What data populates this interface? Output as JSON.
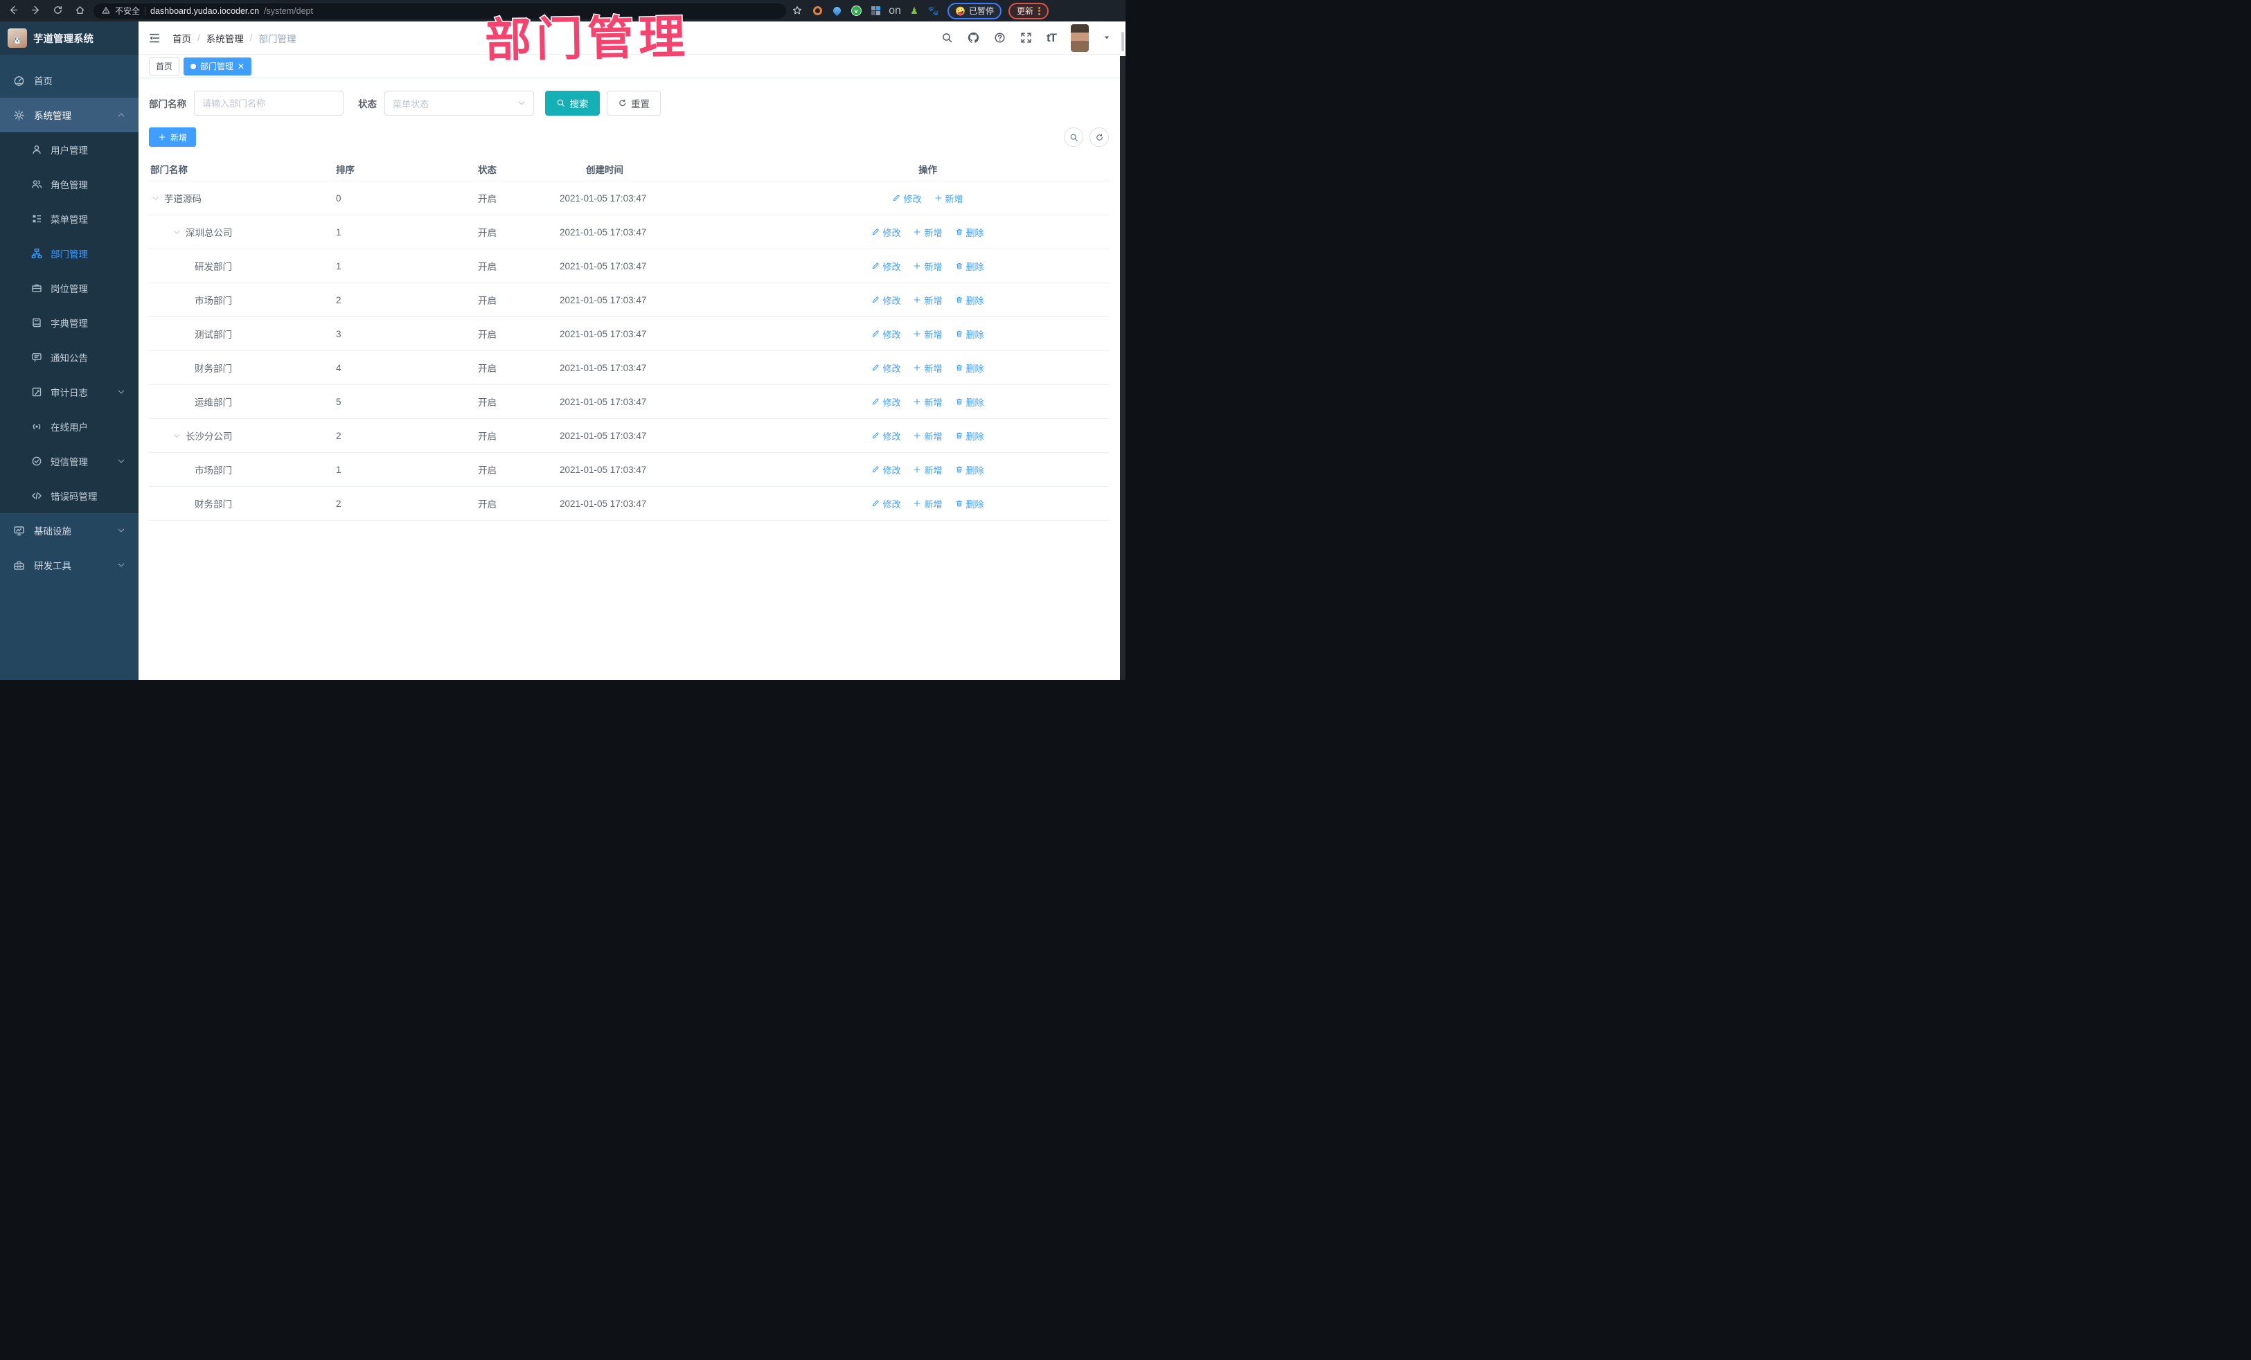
{
  "browser": {
    "security_label": "不安全",
    "url_host": "dashboard.yudao.iocoder.cn",
    "url_path": "/system/dept",
    "paused_label": "已暂停",
    "paused_emoji": "🤪",
    "update_label": "更新",
    "extensions": [
      {
        "name": "extension-orange-ring",
        "type": "ring"
      },
      {
        "name": "extension-blue-drop",
        "type": "drop"
      },
      {
        "name": "extension-green-check",
        "type": "green",
        "glyph": "v"
      },
      {
        "name": "extension-grid",
        "type": "grid"
      },
      {
        "name": "extension-translate-on",
        "type": "onbadge",
        "badge": "on"
      },
      {
        "name": "extension-green-figure",
        "type": "figure",
        "glyph": "♟"
      },
      {
        "name": "extension-paw",
        "type": "paw",
        "glyph": "🐾"
      }
    ]
  },
  "annotation": {
    "text": "部门管理",
    "color": "#f4436e"
  },
  "sidebar": {
    "logo_title": "芋道管理系统",
    "logo_emoji": "🐰",
    "menu": [
      {
        "key": "home",
        "icon": "dashboard",
        "label": "首页"
      },
      {
        "key": "system",
        "icon": "gear",
        "label": "系统管理",
        "chevron": "up",
        "highlight": true,
        "children": [
          {
            "key": "user",
            "icon": "user",
            "label": "用户管理"
          },
          {
            "key": "role",
            "icon": "users",
            "label": "角色管理"
          },
          {
            "key": "menu",
            "icon": "menulist",
            "label": "菜单管理"
          },
          {
            "key": "dept",
            "icon": "depttree",
            "label": "部门管理",
            "active": true
          },
          {
            "key": "post",
            "icon": "briefcase",
            "label": "岗位管理"
          },
          {
            "key": "dict",
            "icon": "book",
            "label": "字典管理"
          },
          {
            "key": "notice",
            "icon": "bubble",
            "label": "通知公告"
          },
          {
            "key": "audit",
            "icon": "audit",
            "label": "审计日志",
            "chevron": "down"
          },
          {
            "key": "online",
            "icon": "online",
            "label": "在线用户"
          },
          {
            "key": "sms",
            "icon": "badge",
            "label": "短信管理",
            "chevron": "down"
          },
          {
            "key": "errcode",
            "icon": "code",
            "label": "错误码管理"
          }
        ]
      },
      {
        "key": "infra",
        "icon": "monitor",
        "label": "基础设施",
        "chevron": "down"
      },
      {
        "key": "devtool",
        "icon": "toolbox",
        "label": "研发工具",
        "chevron": "down"
      }
    ]
  },
  "header": {
    "breadcrumb": [
      "首页",
      "系统管理",
      "部门管理"
    ],
    "icons": [
      {
        "name": "search-icon",
        "icon": "magnifier"
      },
      {
        "name": "github-icon",
        "icon": "github"
      },
      {
        "name": "help-icon",
        "icon": "question"
      },
      {
        "name": "fullscreen-icon",
        "icon": "fullscreen"
      },
      {
        "name": "font-size-icon",
        "icon": "fontsize",
        "glyph": "tT"
      }
    ]
  },
  "tabs": [
    {
      "label": "首页",
      "active": false,
      "closable": false
    },
    {
      "label": "部门管理",
      "active": true,
      "closable": true
    }
  ],
  "filters": {
    "name_label": "部门名称",
    "name_placeholder": "请输入部门名称",
    "status_label": "状态",
    "status_placeholder": "菜单状态",
    "search_label": "搜索",
    "reset_label": "重置"
  },
  "toolbar": {
    "add_label": "新增"
  },
  "table": {
    "headers": [
      "部门名称",
      "排序",
      "状态",
      "创建时间",
      "操作"
    ],
    "rows": [
      {
        "name": "芋道源码",
        "level": 0,
        "expandable": true,
        "sort": "0",
        "status": "开启",
        "time": "2021-01-05 17:03:47",
        "actions": [
          {
            "label": "修改",
            "icon": "edit"
          },
          {
            "label": "新增",
            "icon": "plus"
          }
        ]
      },
      {
        "name": "深圳总公司",
        "level": 1,
        "expandable": true,
        "sort": "1",
        "status": "开启",
        "time": "2021-01-05 17:03:47",
        "actions": [
          {
            "label": "修改",
            "icon": "edit"
          },
          {
            "label": "新增",
            "icon": "plus"
          },
          {
            "label": "删除",
            "icon": "delete"
          }
        ]
      },
      {
        "name": "研发部门",
        "level": 2,
        "expandable": false,
        "sort": "1",
        "status": "开启",
        "time": "2021-01-05 17:03:47",
        "actions": [
          {
            "label": "修改",
            "icon": "edit"
          },
          {
            "label": "新增",
            "icon": "plus"
          },
          {
            "label": "删除",
            "icon": "delete"
          }
        ]
      },
      {
        "name": "市场部门",
        "level": 2,
        "expandable": false,
        "sort": "2",
        "status": "开启",
        "time": "2021-01-05 17:03:47",
        "actions": [
          {
            "label": "修改",
            "icon": "edit"
          },
          {
            "label": "新增",
            "icon": "plus"
          },
          {
            "label": "删除",
            "icon": "delete"
          }
        ]
      },
      {
        "name": "测试部门",
        "level": 2,
        "expandable": false,
        "sort": "3",
        "status": "开启",
        "time": "2021-01-05 17:03:47",
        "actions": [
          {
            "label": "修改",
            "icon": "edit"
          },
          {
            "label": "新增",
            "icon": "plus"
          },
          {
            "label": "删除",
            "icon": "delete"
          }
        ]
      },
      {
        "name": "财务部门",
        "level": 2,
        "expandable": false,
        "sort": "4",
        "status": "开启",
        "time": "2021-01-05 17:03:47",
        "actions": [
          {
            "label": "修改",
            "icon": "edit"
          },
          {
            "label": "新增",
            "icon": "plus"
          },
          {
            "label": "删除",
            "icon": "delete"
          }
        ]
      },
      {
        "name": "运维部门",
        "level": 2,
        "expandable": false,
        "sort": "5",
        "status": "开启",
        "time": "2021-01-05 17:03:47",
        "actions": [
          {
            "label": "修改",
            "icon": "edit"
          },
          {
            "label": "新增",
            "icon": "plus"
          },
          {
            "label": "删除",
            "icon": "delete"
          }
        ]
      },
      {
        "name": "长沙分公司",
        "level": 1,
        "expandable": true,
        "sort": "2",
        "status": "开启",
        "time": "2021-01-05 17:03:47",
        "actions": [
          {
            "label": "修改",
            "icon": "edit"
          },
          {
            "label": "新增",
            "icon": "plus"
          },
          {
            "label": "删除",
            "icon": "delete"
          }
        ]
      },
      {
        "name": "市场部门",
        "level": 2,
        "expandable": false,
        "sort": "1",
        "status": "开启",
        "time": "2021-01-05 17:03:47",
        "actions": [
          {
            "label": "修改",
            "icon": "edit"
          },
          {
            "label": "新增",
            "icon": "plus"
          },
          {
            "label": "删除",
            "icon": "delete"
          }
        ]
      },
      {
        "name": "财务部门",
        "level": 2,
        "expandable": false,
        "sort": "2",
        "status": "开启",
        "time": "2021-01-05 17:03:47",
        "actions": [
          {
            "label": "修改",
            "icon": "edit"
          },
          {
            "label": "新增",
            "icon": "plus"
          },
          {
            "label": "删除",
            "icon": "delete"
          }
        ]
      }
    ]
  },
  "colors": {
    "accent": "#409eff",
    "search_button": "#15b0b5",
    "annotation_pink": "#f4436e",
    "sidebar_bg": "#25465f",
    "submenu_bg": "#1c3444"
  }
}
